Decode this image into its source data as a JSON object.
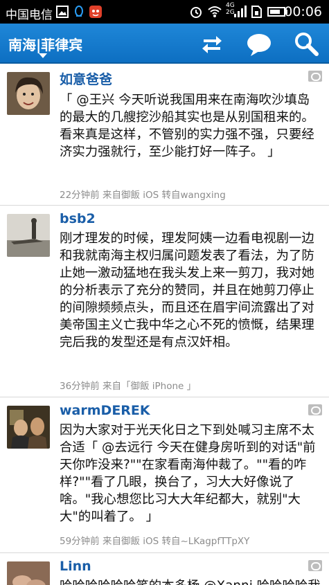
{
  "status_bar": {
    "carrier": "中国电信",
    "time": "00:06",
    "network_badge": "4G 2G",
    "icons": [
      "image-icon",
      "qq-icon",
      "app-icon",
      "alarm-icon",
      "wifi-icon",
      "signal-icon",
      "sim-icon",
      "battery-icon"
    ]
  },
  "app_bar": {
    "title": "南海|菲律宾",
    "buttons": [
      {
        "name": "refresh-button",
        "icon": "refresh-arrows-icon"
      },
      {
        "name": "comment-button",
        "icon": "chat-bubble-icon"
      },
      {
        "name": "search-button",
        "icon": "search-icon"
      }
    ]
  },
  "feed": {
    "posts": [
      {
        "username": "如意爸爸",
        "text": "「 @王兴 今天听说我国用来在南海吹沙填岛的最大的几艘挖沙船其实也是从别国租来的。看来真是这样，不管别的实力强不强，只要经济实力强就行，至少能打好一阵子。 」",
        "meta": "22分钟前 来自御飯 iOS 转自wangxing",
        "avatar": "avatar-person-smiling"
      },
      {
        "username": "bsb2",
        "text": "刚才理发的时候，理发阿姨一边看电视剧一边和我就南海主权归属问题发表了看法，为了防止她一激动猛地在我头发上来一剪刀，我对她的分析表示了充分的赞同，并且在她剪刀停止的间隙频频点头，而且还在眉宇间流露出了对美帝国主义亡我中华之心不死的愤慨，结果理完后我的发型还是有点汉奸相。",
        "meta": "36分钟前 来自「御飯 iPhone 」",
        "avatar": "avatar-old-photo"
      },
      {
        "username": "warmDEREK",
        "text": "因为大家对于光天化日之下到处喊习主席不太合适「 @去远行 今天在健身房听到的对话\"前天你咋没来?\"\"在家看南海仲裁了。\"\"看的咋样?\"\"看了几眼，换台了，习大大好像说了啥。\"我心想您比习大大年纪都大，就别\"大大\"的叫着了。 」",
        "meta": "59分钟前 来自御飯 iOS 转自~LKagpfTTpXY",
        "avatar": "avatar-movie-still"
      },
      {
        "username": "Linn",
        "text": "哈哈哈哈哈哈笑的本多杨 @Xanni 哈哈哈哈我",
        "meta": "",
        "avatar": "avatar-hands"
      }
    ]
  }
}
